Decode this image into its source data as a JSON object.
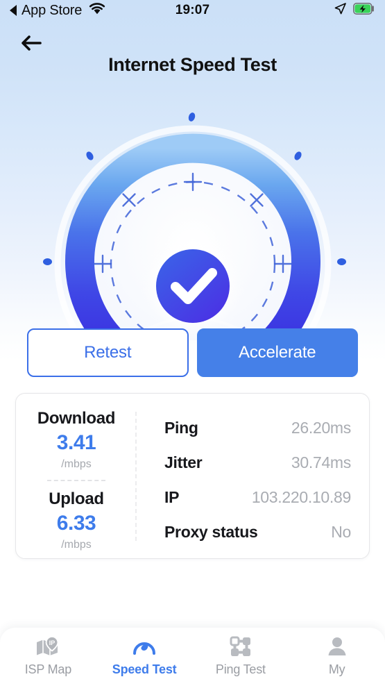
{
  "status_bar": {
    "back_app": "App Store",
    "wifi_icon": "wifi-icon",
    "time": "19:07",
    "location_icon": "location-arrow-icon",
    "battery_icon": "battery-charging-icon"
  },
  "nav": {
    "back_icon": "arrow-left-icon",
    "title": "Internet Speed Test"
  },
  "gauge": {
    "status_icon": "check-circle-icon",
    "state": "complete"
  },
  "actions": {
    "retest_label": "Retest",
    "accelerate_label": "Accelerate"
  },
  "results": {
    "download": {
      "label": "Download",
      "value": "3.41",
      "unit": "/mbps"
    },
    "upload": {
      "label": "Upload",
      "value": "6.33",
      "unit": "/mbps"
    },
    "metrics": [
      {
        "key": "Ping",
        "value": "26.20ms"
      },
      {
        "key": "Jitter",
        "value": "30.74ms"
      },
      {
        "key": "IP",
        "value": "103.220.10.89"
      },
      {
        "key": "Proxy status",
        "value": "No"
      }
    ]
  },
  "tabs": [
    {
      "label": "ISP Map",
      "icon": "map-ip-icon",
      "active": false
    },
    {
      "label": "Speed Test",
      "icon": "speedometer-icon",
      "active": true
    },
    {
      "label": "Ping Test",
      "icon": "network-nodes-icon",
      "active": false
    },
    {
      "label": "My",
      "icon": "user-icon",
      "active": false
    }
  ],
  "colors": {
    "accent": "#3e7ceb",
    "accent_deep": "#3b35e0",
    "arc_light": "#7db4f2",
    "text_muted": "#a9acb2",
    "battery_green": "#3ad35a"
  }
}
